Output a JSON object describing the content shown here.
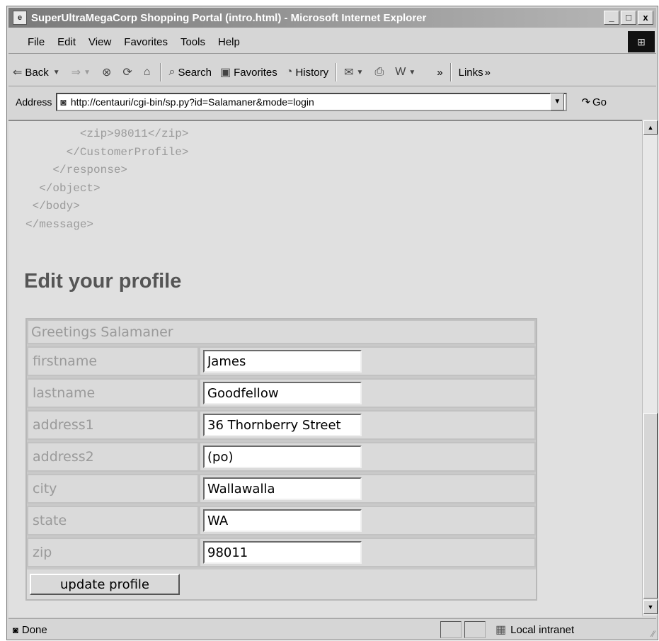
{
  "window": {
    "title": "SuperUltraMegaCorp Shopping Portal (intro.html) - Microsoft Internet Explorer",
    "minimize": "_",
    "maximize": "□",
    "close": "x"
  },
  "menu": {
    "items": [
      "File",
      "Edit",
      "View",
      "Favorites",
      "Tools",
      "Help"
    ]
  },
  "toolbar": {
    "back": "Back",
    "search": "Search",
    "favorites": "Favorites",
    "history": "History",
    "chevron": "»",
    "links": "Links"
  },
  "address": {
    "label": "Address",
    "url": "http://centauri/cgi-bin/sp.py?id=Salamaner&mode=login",
    "go": "Go"
  },
  "page": {
    "xml_lines": [
      "        <zip>98011</zip>",
      "      </CustomerProfile>",
      "    </response>",
      "  </object>",
      " </body>",
      "</message>"
    ],
    "heading": "Edit your profile",
    "greeting": "Greetings Salamaner",
    "fields": [
      {
        "label": "firstname",
        "value": "James"
      },
      {
        "label": "lastname",
        "value": "Goodfellow"
      },
      {
        "label": "address1",
        "value": "36 Thornberry Street"
      },
      {
        "label": "address2",
        "value": "(po)"
      },
      {
        "label": "city",
        "value": "Wallawalla"
      },
      {
        "label": "state",
        "value": "WA"
      },
      {
        "label": "zip",
        "value": "98011"
      }
    ],
    "submit": "update profile"
  },
  "status": {
    "text": "Done",
    "zone": "Local intranet"
  }
}
